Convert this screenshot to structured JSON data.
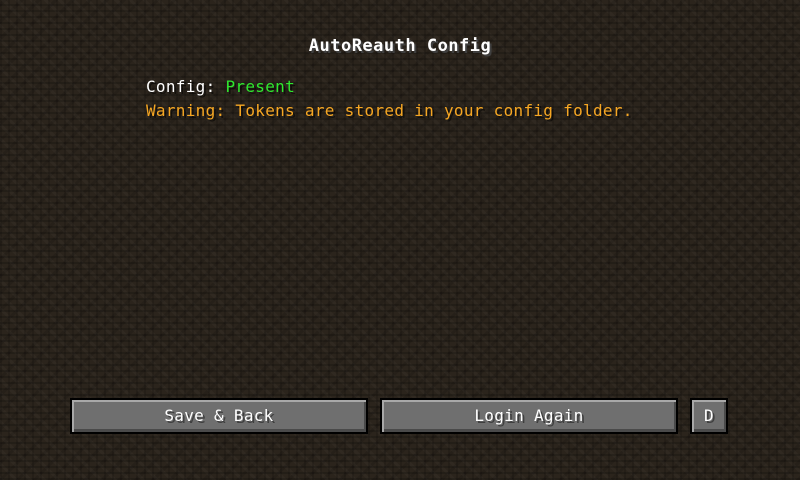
{
  "screen": {
    "title": "AutoReauth Config"
  },
  "status": {
    "config_label": "Config: ",
    "config_value": "Present",
    "config_value_color": "#2ee82e",
    "warning": "Warning: Tokens are stored in your config folder.",
    "warning_color": "#f5a623"
  },
  "buttons": {
    "save_back": "Save & Back",
    "login_again": "Login Again",
    "small": "D"
  }
}
